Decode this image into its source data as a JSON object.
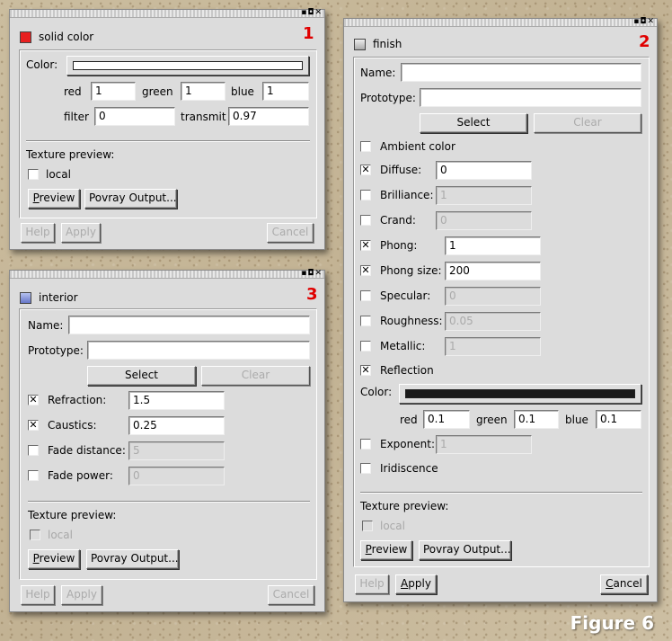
{
  "figure_label": "Figure 6",
  "colors": {
    "solid_swatch": "#e82020",
    "interior_swatch": "#8a9ad8",
    "finish_swatch": "#c8c8c8",
    "reflection_color": "#1a1a1a",
    "marker": "#e00000"
  },
  "titlebar_icons": "▪◘✕",
  "solid": {
    "number": "1",
    "title": "solid color",
    "color_label": "Color:",
    "red_label": "red",
    "red": "1",
    "green_label": "green",
    "green": "1",
    "blue_label": "blue",
    "blue": "1",
    "filter_label": "filter",
    "filter": "0",
    "transmit_label": "transmit",
    "transmit": "0.97",
    "texture_preview": "Texture preview:",
    "local": "local",
    "preview_btn_ul": "P",
    "preview_btn_rest": "review",
    "povray_btn": "Povray Output...",
    "help": "Help",
    "apply": "Apply",
    "cancel": "Cancel"
  },
  "interior": {
    "number": "3",
    "title": "interior",
    "name_label": "Name:",
    "prototype_label": "Prototype:",
    "select": "Select",
    "clear": "Clear",
    "refraction_label": "Refraction:",
    "refraction": "1.5",
    "caustics_label": "Caustics:",
    "caustics": "0.25",
    "fade_distance_label": "Fade distance:",
    "fade_distance": "5",
    "fade_power_label": "Fade power:",
    "fade_power": "0",
    "texture_preview": "Texture preview:",
    "local": "local",
    "preview_btn_ul": "P",
    "preview_btn_rest": "review",
    "povray_btn": "Povray Output...",
    "help": "Help",
    "apply": "Apply",
    "cancel": "Cancel"
  },
  "finish": {
    "number": "2",
    "title": "finish",
    "name_label": "Name:",
    "prototype_label": "Prototype:",
    "select": "Select",
    "clear": "Clear",
    "ambient_label": "Ambient color",
    "diffuse_label": "Diffuse:",
    "diffuse": "0",
    "brilliance_label": "Brilliance:",
    "brilliance": "1",
    "crand_label": "Crand:",
    "crand": "0",
    "phong_label": "Phong:",
    "phong": "1",
    "phong_size_label": "Phong size:",
    "phong_size": "200",
    "specular_label": "Specular:",
    "specular": "0",
    "roughness_label": "Roughness:",
    "roughness": "0.05",
    "metallic_label": "Metallic:",
    "metallic": "1",
    "reflection_label": "Reflection",
    "color_label": "Color:",
    "red_label": "red",
    "red": "0.1",
    "green_label": "green",
    "green": "0.1",
    "blue_label": "blue",
    "blue": "0.1",
    "exponent_label": "Exponent:",
    "exponent": "1",
    "iridescence_label": "Iridiscence",
    "texture_preview": "Texture preview:",
    "local": "local",
    "preview_btn_ul": "P",
    "preview_btn_rest": "review",
    "povray_btn": "Povray Output...",
    "help": "Help",
    "apply_ul": "A",
    "apply_rest": "pply",
    "cancel_ul": "C",
    "cancel_rest": "ancel"
  }
}
